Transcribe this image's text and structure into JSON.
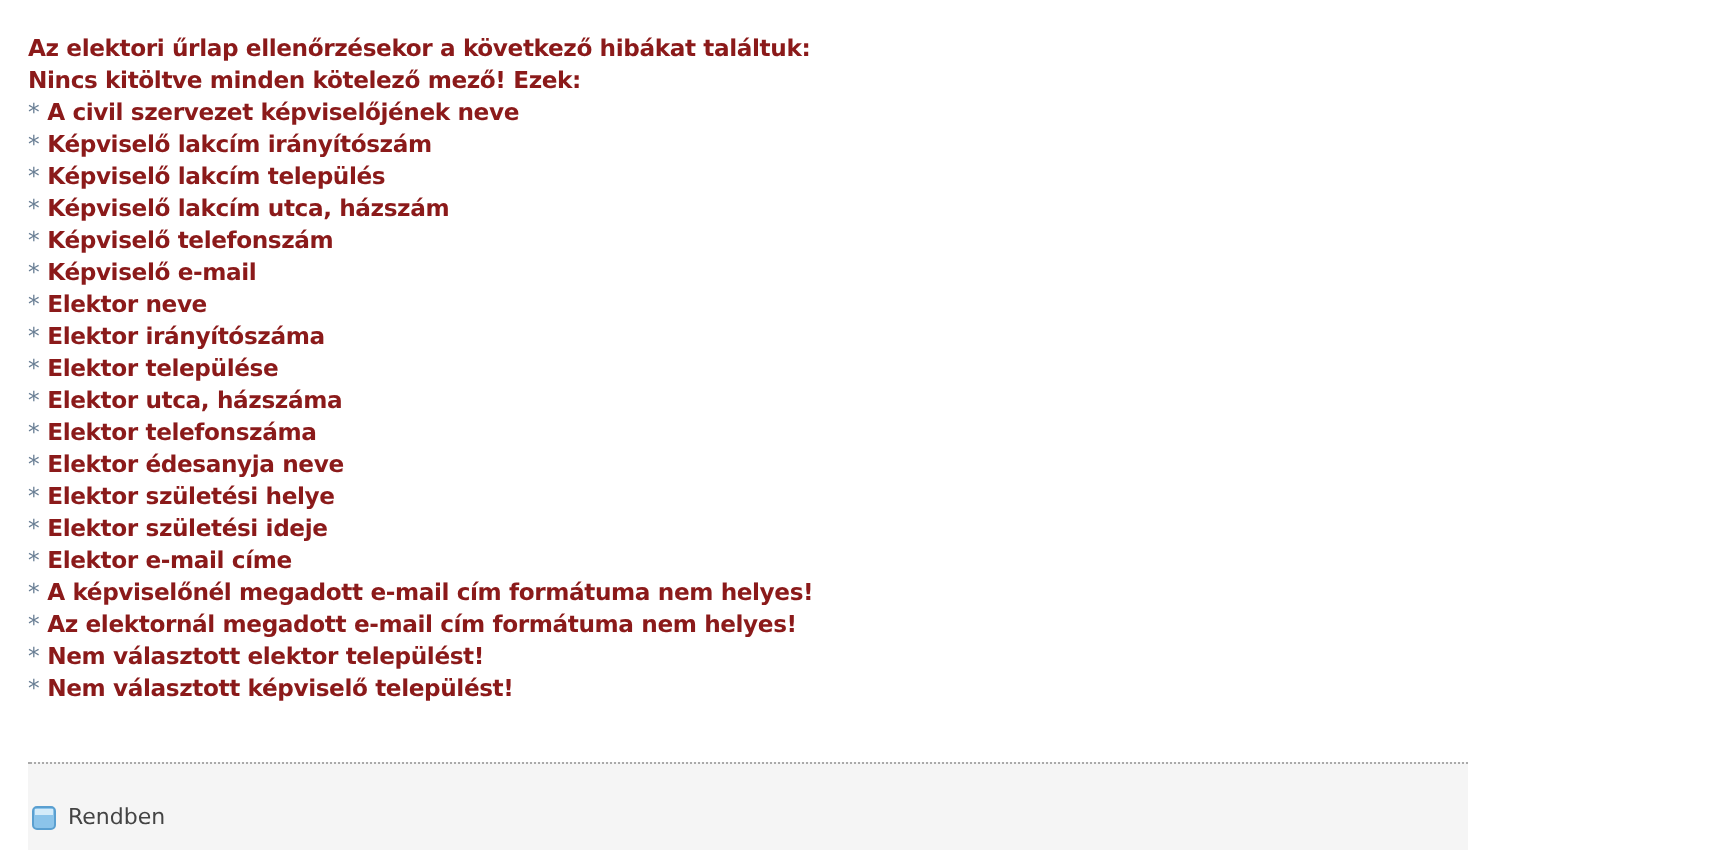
{
  "heading": "Az elektori űrlap ellenőrzésekor a következő hibákat találtuk:",
  "subheading": "Nincs kitöltve minden kötelező mező! Ezek:",
  "errors": [
    {
      "bullet": "*",
      "text": "A civil szervezet képviselőjének neve"
    },
    {
      "bullet": "*",
      "text": "Képviselő lakcím irányítószám"
    },
    {
      "bullet": "*",
      "text": "Képviselő lakcím település"
    },
    {
      "bullet": "*",
      "text": "Képviselő lakcím utca, házszám"
    },
    {
      "bullet": "*",
      "text": "Képviselő telefonszám"
    },
    {
      "bullet": "*",
      "text": "Képviselő e-mail"
    },
    {
      "bullet": "*",
      "text": "Elektor neve"
    },
    {
      "bullet": "*",
      "text": "Elektor irányítószáma"
    },
    {
      "bullet": "*",
      "text": "Elektor települése"
    },
    {
      "bullet": "*",
      "text": "Elektor utca, házszáma"
    },
    {
      "bullet": "*",
      "text": "Elektor telefonszáma"
    },
    {
      "bullet": "*",
      "text": "Elektor édesanyja neve"
    },
    {
      "bullet": "*",
      "text": "Elektor születési helye"
    },
    {
      "bullet": "*",
      "text": "Elektor születési ideje"
    },
    {
      "bullet": "*",
      "text": "Elektor e-mail címe"
    },
    {
      "bullet": "*",
      "text": "A képviselőnél megadott e-mail cím formátuma nem helyes!"
    },
    {
      "bullet": "*",
      "text": "Az elektornál megadott e-mail cím formátuma nem helyes!"
    },
    {
      "bullet": "*",
      "text": "Nem választott elektor települést!"
    },
    {
      "bullet": "*",
      "text": "Nem választott képviselő települést!"
    }
  ],
  "footer": {
    "button": "Rendben"
  }
}
